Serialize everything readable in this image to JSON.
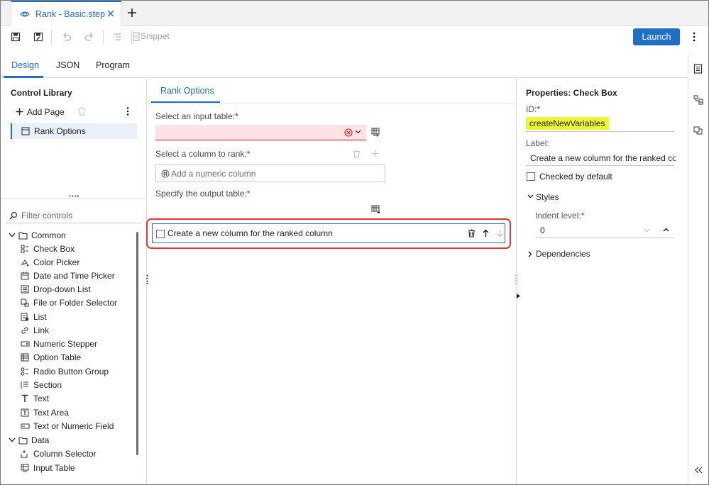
{
  "tab": {
    "title": "Rank - Basic.step"
  },
  "toolbar": {
    "snippet_label": "Snippet",
    "launch_label": "Launch"
  },
  "main_tabs": [
    {
      "label": "Design"
    },
    {
      "label": "JSON"
    },
    {
      "label": "Program"
    }
  ],
  "left": {
    "title": "Control Library",
    "add_page_label": "Add Page",
    "page_item": "Rank Options",
    "filter_placeholder": "Filter controls",
    "groups": [
      {
        "label": "Common",
        "items": [
          "Check Box",
          "Color Picker",
          "Date and Time Picker",
          "Drop-down List",
          "File or Folder Selector",
          "List",
          "Link",
          "Numeric Stepper",
          "Option Table",
          "Radio Button Group",
          "Section",
          "Text",
          "Text Area",
          "Text or Numeric Field"
        ]
      },
      {
        "label": "Data",
        "items": [
          "Column Selector",
          "Input Table"
        ]
      }
    ]
  },
  "center": {
    "page_tab": "Rank Options",
    "input_table_label": "Select an input table:",
    "column_label": "Select a column to rank:",
    "column_placeholder": "Add a numeric column",
    "output_table_label": "Specify the output table:",
    "checkbox_label": "Create a new column for the ranked column",
    "required_mark": "*"
  },
  "properties": {
    "title": "Properties: Check Box",
    "id_label": "ID:",
    "id_value": "createNewVariables",
    "label_label": "Label:",
    "label_value": "Create a new column for the ranked column",
    "checked_default_label": "Checked by default",
    "styles_label": "Styles",
    "indent_label": "Indent level:",
    "indent_value": "0",
    "dependencies_label": "Dependencies"
  },
  "colors": {
    "accent": "#1f6fc5",
    "error": "#c8102e",
    "highlight": "#eef733",
    "callout": "#e0363a"
  }
}
